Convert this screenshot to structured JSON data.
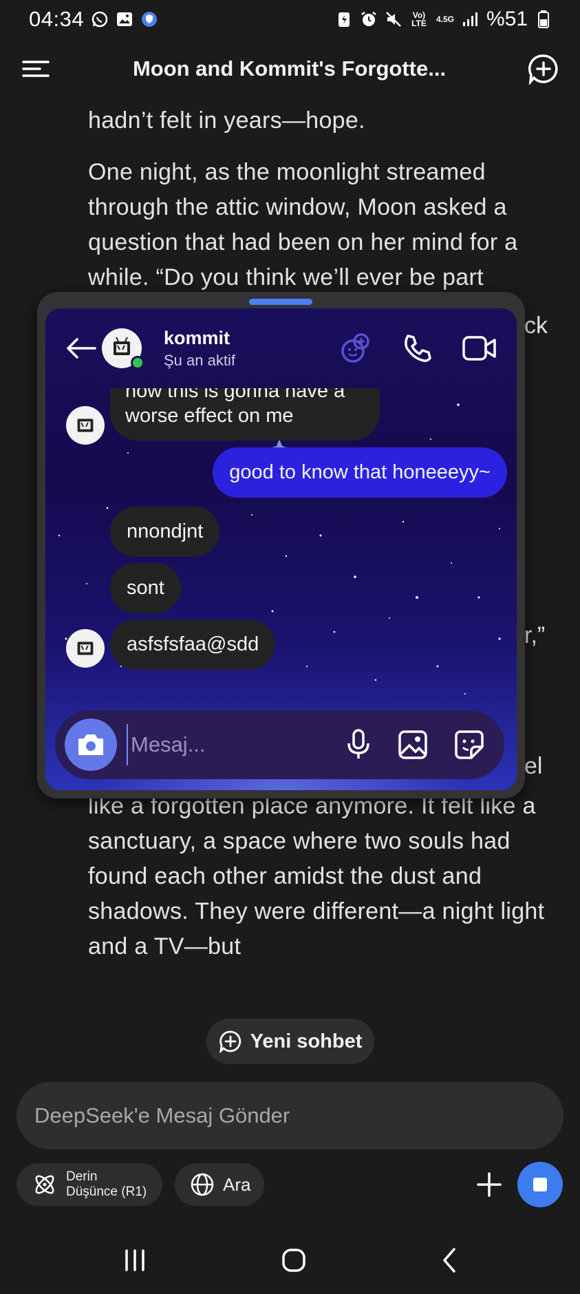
{
  "status_bar": {
    "time": "04:34",
    "network_top": "Vo) LTE",
    "network_speed": "4.5G",
    "battery": "%51"
  },
  "header": {
    "title": "Moon and Kommit's Forgotte..."
  },
  "story": {
    "top_line": "hadn’t felt in years—hope.",
    "para2": "One night, as the moonlight streamed through the attic window, Moon asked a question that had been on her mind for",
    "clipped_line": "a while. “Do you think we’ll ever be part",
    "frag_ck": "ck",
    "frag_r": "r,”",
    "frag_el": "el",
    "bottom": "like a forgotten place anymore. It felt like a sanctuary, a space where two souls had found each other amidst the dust and shadows. They were different—a night light and a TV—but"
  },
  "chat": {
    "contact_name": "kommit",
    "contact_status": "Şu an aktif",
    "messages": [
      {
        "from": "them",
        "text_line1": "now this is gonna have a",
        "text_line2": "worse effect on me"
      },
      {
        "from": "me",
        "text": "good to know that honeeeyy~"
      },
      {
        "from": "them",
        "text": "nnondjnt"
      },
      {
        "from": "them",
        "text": "sont"
      },
      {
        "from": "them",
        "text": "asfsfsfaa@sdd"
      }
    ],
    "composer_placeholder": "Mesaj..."
  },
  "bottom": {
    "new_chat_label": "Yeni sohbet",
    "input_placeholder": "DeepSeek'e Mesaj Gönder",
    "deep_think_line1": "Derin",
    "deep_think_line2": "Düşünce (R1)",
    "search_label": "Ara"
  },
  "colors": {
    "accent_blue": "#3d7bf0",
    "sent_bubble": "#2b22e0",
    "online": "#34c34d"
  }
}
